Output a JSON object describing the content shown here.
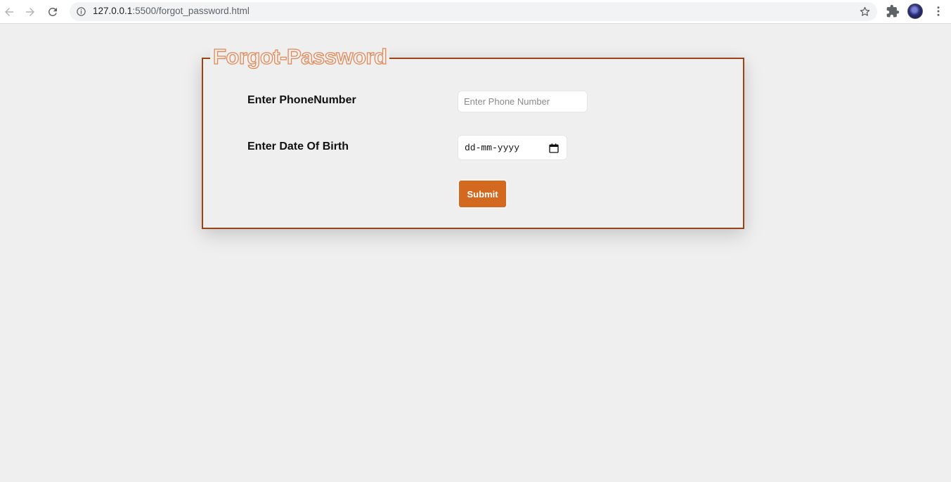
{
  "browser": {
    "url_host": "127.0.0.1",
    "url_rest": ":5500/forgot_password.html"
  },
  "form": {
    "legend": "Forgot-Password",
    "phone_label": "Enter PhoneNumber",
    "phone_placeholder": "Enter Phone Number",
    "phone_value": "",
    "dob_label": "Enter Date Of Birth",
    "dob_format": "dd-mm-yyyy",
    "submit_label": "Submit"
  },
  "colors": {
    "page_background": "#efefef",
    "fieldset_border": "#9a4416",
    "legend_outline": "#e08a58",
    "submit_background": "#d2691e"
  },
  "icons": [
    "back-arrow-icon",
    "forward-arrow-icon",
    "reload-icon",
    "info-icon",
    "star-icon",
    "puzzle-icon",
    "kebab-menu-icon",
    "calendar-icon"
  ]
}
